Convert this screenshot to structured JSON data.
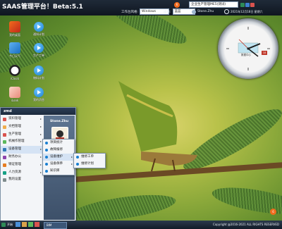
{
  "app": {
    "title": "SAAS管理平台！Beta:5.1"
  },
  "topbar": {
    "workspace_label": "工作台风格:",
    "workspace_value": "Windows",
    "theme_label": "皮肤:",
    "theme_value": "蓝蓝",
    "badge_count": "6",
    "system_select": "企业生产管理ME5(测试)",
    "user_name": "Stone.Zhu",
    "datetime": "2021年12月18日 星期六"
  },
  "desktop_icons": [
    {
      "label": "我的桌面",
      "color": "#e04a2a"
    },
    {
      "label": "通知计划"
    },
    {
      "label": "今日天气",
      "color": "#2a7fd1"
    },
    {
      "label": "生产工单"
    },
    {
      "label": "iClock",
      "color": "#ffffff"
    },
    {
      "label": "物料计划"
    },
    {
      "label": "iLook",
      "color": "#f08a7a"
    },
    {
      "label": "我的消息"
    }
  ],
  "clock": {
    "brand": "数据中心",
    "day": "18"
  },
  "start_menu": {
    "user": "zmd",
    "items": [
      {
        "label": "资料管理",
        "color": "#d9534f"
      },
      {
        "label": "文档管理",
        "color": "#f0ad4e"
      },
      {
        "label": "生产管理",
        "color": "#d9534f"
      },
      {
        "label": "机械作管理",
        "color": "#5cb85c"
      },
      {
        "label": "设备管理",
        "color": "#337ab7"
      },
      {
        "label": "财务办公",
        "color": "#8e44ad"
      },
      {
        "label": "销证管理",
        "color": "#e67e22"
      },
      {
        "label": "人力资源",
        "color": "#16a085"
      },
      {
        "label": "我的设置",
        "color": "#7f8c8d"
      }
    ],
    "side_user": "Stone.Zhu"
  },
  "submenu1": {
    "items": [
      {
        "label": "项目统计"
      },
      {
        "label": "故障报修"
      },
      {
        "label": "设备维护"
      },
      {
        "label": "设备保养"
      },
      {
        "label": "知识库"
      }
    ]
  },
  "submenu2": {
    "items": [
      {
        "label": "维修工单"
      },
      {
        "label": "维修计划"
      }
    ]
  },
  "taskbar": {
    "start_label": "开始",
    "active_window": "BIM",
    "copyright": "Copyright @2016-2021 ALL RIGHTS RESERVED"
  },
  "notification": {
    "count": "6"
  },
  "colors": {
    "accent": "#1a7fd1",
    "badge": "#f26b1d",
    "topbar": "#1f2a38"
  }
}
